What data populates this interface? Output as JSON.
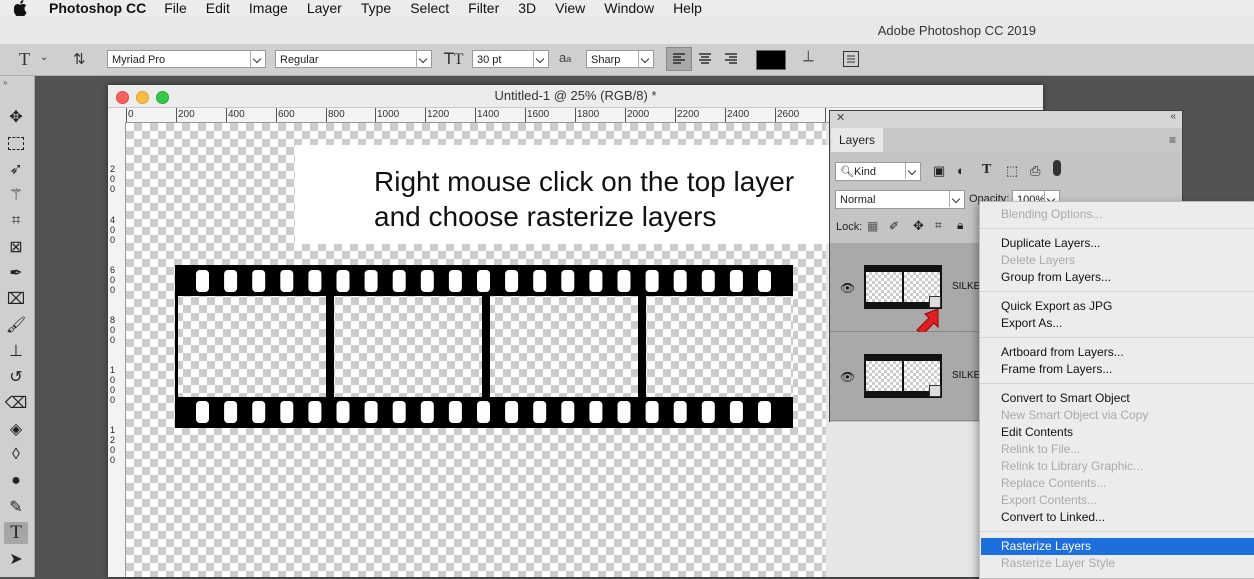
{
  "menubar": {
    "app": "Photoshop CC",
    "items": [
      "File",
      "Edit",
      "Image",
      "Layer",
      "Type",
      "Select",
      "Filter",
      "3D",
      "View",
      "Window",
      "Help"
    ]
  },
  "app_window": {
    "title": "Adobe Photoshop CC 2019"
  },
  "options_bar": {
    "font_family": "Myriad Pro",
    "font_style": "Regular",
    "font_size": "30 pt",
    "antialias_label": "a",
    "antialias": "Sharp",
    "text_color": "#000000"
  },
  "document": {
    "title": "Untitled-1 @ 25% (RGB/8) *",
    "ruler_ticks": [
      "0",
      "200",
      "400",
      "600",
      "800",
      "1000",
      "1200",
      "1400",
      "1600",
      "1800",
      "2000",
      "2200",
      "2400",
      "2600"
    ],
    "vertical_ruler_marks": [
      "2",
      "0",
      "0",
      "4",
      "0",
      "0",
      "6",
      "0",
      "0",
      "8",
      "0",
      "0",
      "1",
      "0",
      "0",
      "0",
      "1",
      "2",
      "0",
      "0"
    ],
    "annotation_lines": [
      "Right mouse click on the top layer",
      "and choose rasterize layers"
    ]
  },
  "layers_panel": {
    "tab": "Layers",
    "filter_kind": "Kind",
    "blend_mode": "Normal",
    "opacity_label": "Opacity:",
    "opacity_value": "100%",
    "lock_label": "Lock:",
    "layers": [
      {
        "name": "SILKE"
      },
      {
        "name": "SILKE"
      }
    ]
  },
  "context_menu": {
    "groups": [
      [
        {
          "label": "Blending Options...",
          "enabled": false
        }
      ],
      [
        {
          "label": "Duplicate Layers...",
          "enabled": true
        },
        {
          "label": "Delete Layers",
          "enabled": false
        },
        {
          "label": "Group from Layers...",
          "enabled": true
        }
      ],
      [
        {
          "label": "Quick Export as JPG",
          "enabled": true
        },
        {
          "label": "Export As...",
          "enabled": true
        }
      ],
      [
        {
          "label": "Artboard from Layers...",
          "enabled": true
        },
        {
          "label": "Frame from Layers...",
          "enabled": true
        }
      ],
      [
        {
          "label": "Convert to Smart Object",
          "enabled": true
        },
        {
          "label": "New Smart Object via Copy",
          "enabled": false
        },
        {
          "label": "Edit Contents",
          "enabled": true
        },
        {
          "label": "Relink to File...",
          "enabled": false
        },
        {
          "label": "Relink to Library Graphic...",
          "enabled": false
        },
        {
          "label": "Replace Contents...",
          "enabled": false
        },
        {
          "label": "Export Contents...",
          "enabled": false
        },
        {
          "label": "Convert to Linked...",
          "enabled": true
        }
      ],
      [
        {
          "label": "Rasterize Layers",
          "enabled": true,
          "highlighted": true
        },
        {
          "label": "Rasterize Layer Style",
          "enabled": false
        }
      ]
    ],
    "highlight_color": "#1e6fde"
  }
}
